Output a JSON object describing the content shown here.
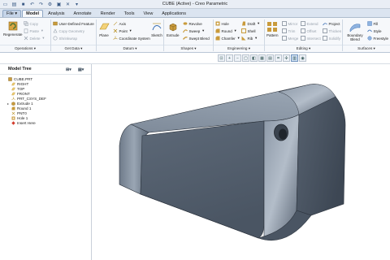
{
  "window": {
    "title": "CUBE (Active) - Creo Parametric"
  },
  "quick_access": [
    "new",
    "open",
    "save",
    "undo",
    "redo",
    "regenerate",
    "windows",
    "close",
    "more"
  ],
  "tabs": [
    "File",
    "Model",
    "Analysis",
    "Annotate",
    "Render",
    "Tools",
    "View",
    "Applications"
  ],
  "ribbon": {
    "operations": {
      "label": "Operations",
      "regenerate": "Regenerate",
      "copy": "Copy",
      "paste": "Paste",
      "delete": "Delete"
    },
    "get_data": {
      "label": "Get Data",
      "user_defined_feature": "User-Defined Feature",
      "copy_geometry": "Copy Geometry",
      "shrinkwrap": "Shrinkwrap"
    },
    "datum": {
      "label": "Datum",
      "plane": "Plane",
      "axis": "Axis",
      "point": "Point",
      "coordinate_system": "Coordinate System",
      "sketch": "Sketch"
    },
    "shapes": {
      "label": "Shapes",
      "extrude": "Extrude",
      "revolve": "Revolve",
      "sweep": "Sweep",
      "swept_blend": "Swept Blend"
    },
    "engineering": {
      "label": "Engineering",
      "hole": "Hole",
      "round": "Round",
      "chamfer": "Chamfer",
      "draft": "Draft",
      "shell": "Shell",
      "rib": "Rib"
    },
    "editing": {
      "label": "Editing",
      "pattern": "Pattern",
      "mirror": "Mirror",
      "extend": "Extend",
      "project": "Project",
      "trim": "Trim",
      "offset": "Offset",
      "thicken": "Thicken",
      "merge": "Merge",
      "intersect": "Intersect",
      "solidify": "Solidify"
    },
    "surfaces": {
      "label": "Surfaces",
      "fill": "Fill",
      "boundary_blend": "Boundary Blend",
      "style": "Style",
      "freestyle": "Freestyle"
    }
  },
  "model_tree": {
    "title": "Model Tree",
    "items": [
      {
        "label": "CUBE.PRT",
        "icon": "part-icon",
        "expander": ""
      },
      {
        "label": "RIGHT",
        "icon": "datum-plane-icon",
        "expander": ""
      },
      {
        "label": "TOP",
        "icon": "datum-plane-icon",
        "expander": ""
      },
      {
        "label": "FRONT",
        "icon": "datum-plane-icon",
        "expander": ""
      },
      {
        "label": "PRT_CSYS_DEF",
        "icon": "csys-icon",
        "expander": ""
      },
      {
        "label": "Extrude 1",
        "icon": "extrude-icon",
        "expander": "▸"
      },
      {
        "label": "Round 1",
        "icon": "round-icon",
        "expander": ""
      },
      {
        "label": "PNT0",
        "icon": "datum-point-icon",
        "expander": ""
      },
      {
        "label": "Hole 1",
        "icon": "hole-icon",
        "expander": ""
      },
      {
        "label": "Insert Here",
        "icon": "insert-here-icon",
        "expander": ""
      }
    ]
  },
  "view_toolbar": [
    "refit",
    "zoom-in",
    "zoom-out",
    "repaint",
    "display-style",
    "saved-views",
    "view-manager",
    "datum-display",
    "spin-center",
    "annotation-display",
    "appearance"
  ]
}
